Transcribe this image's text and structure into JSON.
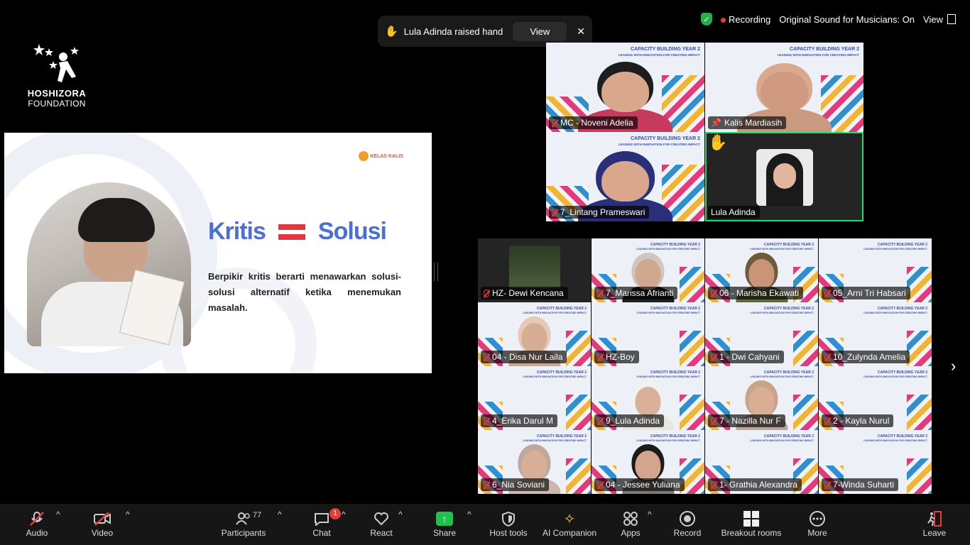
{
  "logo": {
    "name": "HOSHIZORA",
    "sub": "FOUNDATION"
  },
  "slide": {
    "brand": "KELAS\nKALIS",
    "title_left": "Kritis",
    "title_right": "Solusi",
    "body": "Berpikir kritis berarti menawarkan solusi-solusi alternatif ketika menemukan masalah."
  },
  "notification": {
    "text": "Lula Adinda raised hand",
    "view_label": "View",
    "close": "✕"
  },
  "status": {
    "recording": "Recording",
    "sound": "Original Sound for Musicians: On",
    "view": "View"
  },
  "tile_caption": {
    "title": "CAPACITY BUILDING YEAR 2",
    "sub": "LEADING WITH INNOVATION FOR CREATING IMPACT"
  },
  "top_tiles": [
    {
      "name": "MC - Noveni Adelia"
    },
    {
      "name": "Kalis Mardiasih"
    },
    {
      "name": "7_Lintang Prameswari"
    },
    {
      "name": "Lula Adinda"
    }
  ],
  "grid_tiles": [
    {
      "name": "HZ- Dewi Kencana"
    },
    {
      "name": "7_Marissa Afrianti"
    },
    {
      "name": "06 - Marisha Ekawati"
    },
    {
      "name": "05_Arni Tri Habsari"
    },
    {
      "name": "04 - Disa Nur Laila"
    },
    {
      "name": "HZ-Boy"
    },
    {
      "name": "1 - Dwi Cahyani"
    },
    {
      "name": "10_Zulynda Amelia"
    },
    {
      "name": "4_Erika Darul M"
    },
    {
      "name": "9_Lula Adinda"
    },
    {
      "name": "7 - Nazilla Nur F"
    },
    {
      "name": "2 - Kayla Nurul"
    },
    {
      "name": "6_Nia Soviani"
    },
    {
      "name": "04 - Jessee Yuliana"
    },
    {
      "name": "1- Grathia Alexandra"
    },
    {
      "name": "7-Winda Suharti"
    }
  ],
  "toolbar": {
    "audio": "Audio",
    "video": "Video",
    "participants": "Participants",
    "participants_count": "77",
    "chat": "Chat",
    "chat_badge": "1",
    "react": "React",
    "share": "Share",
    "host_tools": "Host tools",
    "ai": "AI Companion",
    "apps": "Apps",
    "record": "Record",
    "breakout": "Breakout rooms",
    "more": "More",
    "leave": "Leave"
  },
  "colors": {
    "accent_green": "#2bd66a",
    "rec_red": "#e83b3b",
    "slide_blue": "#4c6fd6",
    "equals_red": "#e0383f"
  }
}
